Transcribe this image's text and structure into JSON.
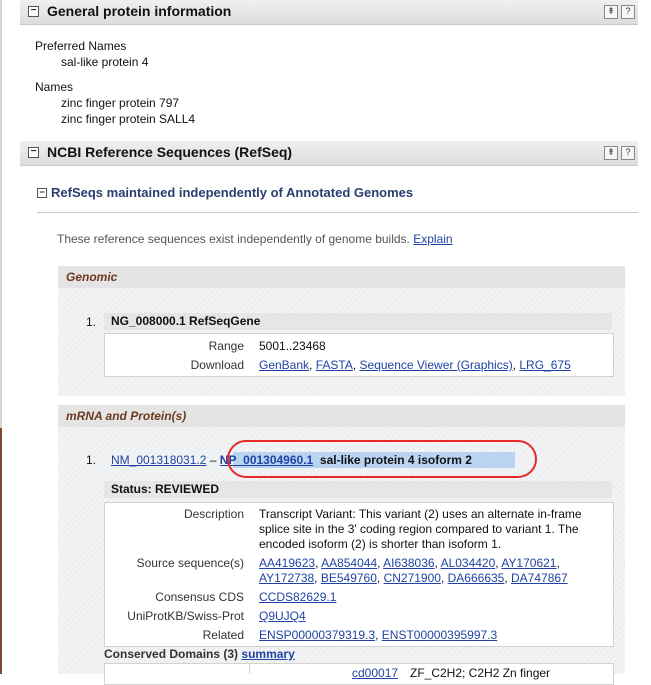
{
  "general": {
    "title": "General protein information",
    "preferred_label": "Preferred Names",
    "preferred_value": "sal-like protein 4",
    "names_label": "Names",
    "names": [
      "zinc finger protein 797",
      "zinc finger protein SALL4"
    ]
  },
  "refseq": {
    "title": "NCBI Reference Sequences (RefSeq)",
    "subsection_title": "RefSeqs maintained independently of Annotated Genomes",
    "note": "These reference sequences exist independently of genome builds.",
    "explain_link": "Explain",
    "genomic": {
      "heading": "Genomic",
      "item_number": "1.",
      "item_title": "NG_008000.1 RefSeqGene",
      "range_label": "Range",
      "range_value": "5001..23468",
      "download_label": "Download",
      "downloads": [
        "GenBank",
        "FASTA",
        "Sequence Viewer (Graphics)",
        "LRG_675"
      ]
    },
    "mrna": {
      "heading": "mRNA and Protein(s)",
      "item_number": "1.",
      "nm": "NM_001318031.2",
      "dash": "–",
      "np": "NP_001304960.1",
      "np_title": "sal-like protein 4 isoform 2",
      "status": "Status: REVIEWED",
      "description_label": "Description",
      "description_lines": [
        "Transcript Variant: This variant (2) uses an alternate in-frame",
        "splice site in the 3' coding region compared to variant 1. The",
        "encoded isoform (2) is shorter than isoform 1."
      ],
      "source_label": "Source sequence(s)",
      "source_line1": [
        "AA419623",
        "AA854044",
        "AI638036",
        "AL034420",
        "AY170621"
      ],
      "source_line2": [
        "AY172738",
        "BE549760",
        "CN271900",
        "DA666635",
        "DA747867"
      ],
      "ccds_label": "Consensus CDS",
      "ccds": "CCDS82629.1",
      "uniprot_label": "UniProtKB/Swiss-Prot",
      "uniprot": "Q9UJQ4",
      "related_label": "Related",
      "related": [
        "ENSP00000379319.3",
        "ENST00000395997.3"
      ],
      "conserved_label": "Conserved Domains (3)",
      "conserved_link": "summary",
      "cd_id": "cd00017",
      "cd_desc": "ZF_C2H2; C2H2 Zn finger"
    }
  },
  "icons": [
    "collapse-icon",
    "up-icon",
    "help-icon"
  ],
  "colors": {
    "link": "#2143a5",
    "heading_brown": "#6b3a1f",
    "circle": "#e62a2a",
    "highlight": "#b8d4f1"
  }
}
